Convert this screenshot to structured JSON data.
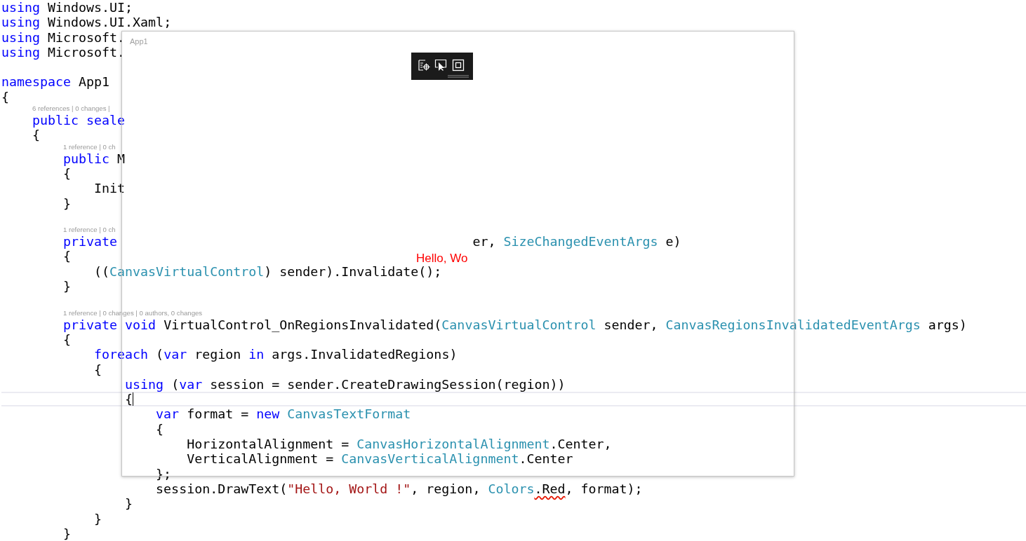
{
  "editor": {
    "lines": [
      {
        "kind": "code",
        "tokens": [
          {
            "t": "using",
            "kind": "kw"
          },
          {
            "t": " Windows.UI;",
            "kind": "plain"
          }
        ]
      },
      {
        "kind": "code",
        "tokens": [
          {
            "t": "using",
            "kind": "kw"
          },
          {
            "t": " Windows.UI.Xaml;",
            "kind": "plain"
          }
        ]
      },
      {
        "kind": "code",
        "tokens": [
          {
            "t": "using",
            "kind": "kw"
          },
          {
            "t": " Microsoft.",
            "kind": "plain"
          }
        ]
      },
      {
        "kind": "code",
        "tokens": [
          {
            "t": "using",
            "kind": "kw"
          },
          {
            "t": " Microsoft.",
            "kind": "plain"
          }
        ]
      },
      {
        "kind": "blank"
      },
      {
        "kind": "code",
        "tokens": [
          {
            "t": "namespace",
            "kind": "kw"
          },
          {
            "t": " App1",
            "kind": "plain"
          }
        ]
      },
      {
        "kind": "code",
        "tokens": [
          {
            "t": "{",
            "kind": "plain"
          }
        ],
        "children": [
          {
            "kind": "lens",
            "text": "6 references | 0 changes |"
          },
          {
            "kind": "code",
            "tokens": [
              {
                "t": "public seale",
                "kind": "kw"
              }
            ]
          },
          {
            "kind": "code",
            "tokens": [
              {
                "t": "{",
                "kind": "plain"
              }
            ],
            "children": [
              {
                "kind": "lens",
                "text": "1 reference | 0 ch"
              },
              {
                "kind": "code",
                "tokens": [
                  {
                    "t": "public",
                    "kind": "kw"
                  },
                  {
                    "t": " M",
                    "kind": "plain"
                  }
                ]
              },
              {
                "kind": "code",
                "tokens": [
                  {
                    "t": "{",
                    "kind": "plain"
                  }
                ],
                "children": [
                  {
                    "kind": "code",
                    "tokens": [
                      {
                        "t": "Init",
                        "kind": "plain"
                      }
                    ]
                  }
                ]
              },
              {
                "kind": "code",
                "tokens": [
                  {
                    "t": "}",
                    "kind": "plain"
                  }
                ]
              },
              {
                "kind": "blank"
              },
              {
                "kind": "lens",
                "text": "1 reference | 0 ch"
              },
              {
                "kind": "code",
                "tokens": [
                  {
                    "t": "private",
                    "kind": "kw"
                  }
                ],
                "tail": [
                  {
                    "t": "er, ",
                    "kind": "plain"
                  },
                  {
                    "t": "SizeChangedEventArgs",
                    "kind": "type"
                  },
                  {
                    "t": " e)",
                    "kind": "plain"
                  }
                ]
              },
              {
                "kind": "code",
                "tokens": [
                  {
                    "t": "{",
                    "kind": "plain"
                  }
                ],
                "children": [
                  {
                    "kind": "code",
                    "tokens": [
                      {
                        "t": "((",
                        "kind": "plain"
                      },
                      {
                        "t": "CanvasVirtualControl",
                        "kind": "type"
                      },
                      {
                        "t": ") sender).Invalidate();",
                        "kind": "plain"
                      }
                    ]
                  }
                ]
              },
              {
                "kind": "code",
                "tokens": [
                  {
                    "t": "}",
                    "kind": "plain"
                  }
                ]
              },
              {
                "kind": "blank"
              },
              {
                "kind": "lens",
                "text": "1 reference | 0 changes | 0 authors, 0 changes"
              },
              {
                "kind": "code",
                "tokens": [
                  {
                    "t": "private void",
                    "kind": "kw"
                  },
                  {
                    "t": " VirtualControl_OnRegionsInvalidated(",
                    "kind": "plain"
                  },
                  {
                    "t": "CanvasVirtualControl",
                    "kind": "type"
                  },
                  {
                    "t": " sender, ",
                    "kind": "plain"
                  },
                  {
                    "t": "CanvasRegionsInvalidatedEventArgs",
                    "kind": "type"
                  },
                  {
                    "t": " args)",
                    "kind": "plain"
                  }
                ]
              },
              {
                "kind": "code",
                "tokens": [
                  {
                    "t": "{",
                    "kind": "plain"
                  }
                ],
                "children": [
                  {
                    "kind": "code",
                    "tokens": [
                      {
                        "t": "foreach",
                        "kind": "kw"
                      },
                      {
                        "t": " (",
                        "kind": "plain"
                      },
                      {
                        "t": "var",
                        "kind": "kw"
                      },
                      {
                        "t": " region ",
                        "kind": "plain"
                      },
                      {
                        "t": "in",
                        "kind": "kw"
                      },
                      {
                        "t": " args.InvalidatedRegions)",
                        "kind": "plain"
                      }
                    ]
                  },
                  {
                    "kind": "code",
                    "tokens": [
                      {
                        "t": "{",
                        "kind": "plain"
                      }
                    ],
                    "children": [
                      {
                        "kind": "code",
                        "tokens": [
                          {
                            "t": "using",
                            "kind": "kw"
                          },
                          {
                            "t": " (",
                            "kind": "plain"
                          },
                          {
                            "t": "var",
                            "kind": "kw"
                          },
                          {
                            "t": " session = sender.CreateDrawingSession(region))",
                            "kind": "plain"
                          }
                        ]
                      },
                      {
                        "kind": "code",
                        "current": true,
                        "tokens": [
                          {
                            "t": "{",
                            "kind": "plain"
                          }
                        ],
                        "children": [
                          {
                            "kind": "code",
                            "tokens": [
                              {
                                "t": "var",
                                "kind": "kw"
                              },
                              {
                                "t": " format = ",
                                "kind": "plain"
                              },
                              {
                                "t": "new",
                                "kind": "kw"
                              },
                              {
                                "t": " CanvasTextFormat",
                                "kind": "type"
                              }
                            ]
                          },
                          {
                            "kind": "code",
                            "tokens": [
                              {
                                "t": "{",
                                "kind": "plain"
                              }
                            ],
                            "children": [
                              {
                                "kind": "code",
                                "tokens": [
                                  {
                                    "t": "HorizontalAlignment = ",
                                    "kind": "plain"
                                  },
                                  {
                                    "t": "CanvasHorizontalAlignment",
                                    "kind": "type"
                                  },
                                  {
                                    "t": ".Center,",
                                    "kind": "plain"
                                  }
                                ]
                              },
                              {
                                "kind": "code",
                                "tokens": [
                                  {
                                    "t": "VerticalAlignment = ",
                                    "kind": "plain"
                                  },
                                  {
                                    "t": "CanvasVerticalAlignment",
                                    "kind": "type"
                                  },
                                  {
                                    "t": ".Center",
                                    "kind": "plain"
                                  }
                                ]
                              }
                            ]
                          },
                          {
                            "kind": "code",
                            "tokens": [
                              {
                                "t": "};",
                                "kind": "plain"
                              }
                            ]
                          },
                          {
                            "kind": "code",
                            "tokens": [
                              {
                                "t": "session.DrawText(",
                                "kind": "plain"
                              },
                              {
                                "t": "\"Hello, World !\"",
                                "kind": "str"
                              },
                              {
                                "t": ", region, ",
                                "kind": "plain"
                              },
                              {
                                "t": "Colors",
                                "kind": "type"
                              },
                              {
                                "t": ".Red",
                                "kind": "plain",
                                "squiggle": true
                              },
                              {
                                "t": ", format);",
                                "kind": "plain"
                              }
                            ]
                          }
                        ]
                      },
                      {
                        "kind": "code",
                        "tokens": [
                          {
                            "t": "}",
                            "kind": "plain"
                          }
                        ]
                      }
                    ]
                  },
                  {
                    "kind": "code",
                    "tokens": [
                      {
                        "t": "}",
                        "kind": "plain"
                      }
                    ]
                  }
                ]
              },
              {
                "kind": "code",
                "tokens": [
                  {
                    "t": "}",
                    "kind": "plain"
                  }
                ]
              }
            ]
          }
        ]
      }
    ]
  },
  "app_window": {
    "title": "App1",
    "canvas_text": "Hello, Wo"
  }
}
